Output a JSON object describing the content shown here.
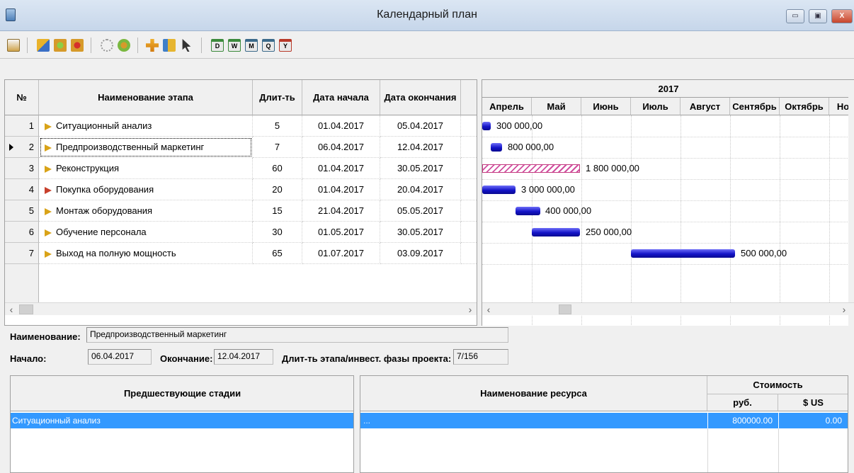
{
  "window": {
    "title": "Календарный план",
    "buttons": {
      "minimize": "▭",
      "maximize": "▣",
      "close": "X"
    }
  },
  "toolbar": {
    "icons": [
      "calendar-icon",
      "arrow-add-icon",
      "gear-green-icon",
      "gear-red-icon",
      "link-icon",
      "gear-link-icon",
      "plus-icon",
      "tree-icon",
      "pointer-icon",
      "day-icon",
      "week-icon",
      "month-icon",
      "quarter-icon",
      "year-icon"
    ],
    "scale_labels": [
      "D",
      "W",
      "M",
      "Q",
      "Y"
    ]
  },
  "table": {
    "headers": {
      "num": "№",
      "name": "Наименование этапа",
      "duration": "Длит-ть",
      "start": "Дата начала",
      "end": "Дата окончания"
    },
    "rows": [
      {
        "num": "1",
        "name": "Ситуационный анализ",
        "duration": "5",
        "start": "01.04.2017",
        "end": "05.04.2017",
        "cost": "300 000,00",
        "red": false
      },
      {
        "num": "2",
        "name": "Предпроизводственный маркетинг",
        "duration": "7",
        "start": "06.04.2017",
        "end": "12.04.2017",
        "cost": "800 000,00",
        "red": false,
        "selected": true
      },
      {
        "num": "3",
        "name": "Реконструкция",
        "duration": "60",
        "start": "01.04.2017",
        "end": "30.05.2017",
        "cost": "1 800 000,00",
        "red": false,
        "hatched": true
      },
      {
        "num": "4",
        "name": "Покупка оборудования",
        "duration": "20",
        "start": "01.04.2017",
        "end": "20.04.2017",
        "cost": "3 000 000,00",
        "red": true
      },
      {
        "num": "5",
        "name": "Монтаж оборудования",
        "duration": "15",
        "start": "21.04.2017",
        "end": "05.05.2017",
        "cost": "400 000,00",
        "red": false
      },
      {
        "num": "6",
        "name": "Обучение персонала",
        "duration": "30",
        "start": "01.05.2017",
        "end": "30.05.2017",
        "cost": "250 000,00",
        "red": false
      },
      {
        "num": "7",
        "name": "Выход на полную мощность",
        "duration": "65",
        "start": "01.07.2017",
        "end": "03.09.2017",
        "cost": "500 000,00",
        "red": false
      }
    ]
  },
  "gantt": {
    "year": "2017",
    "months": [
      "Апрель",
      "Май",
      "Июнь",
      "Июль",
      "Август",
      "Сентябрь",
      "Октябрь",
      "Но"
    ],
    "timeline_start": "2017-04-01"
  },
  "details": {
    "name_label": "Наименование:",
    "name_value": "Предпроизводственный маркетинг",
    "start_label": "Начало:",
    "start_value": "06.04.2017",
    "end_label": "Окончание:",
    "end_value": "12.04.2017",
    "phase_label": "Длит-ть этапа/инвест. фазы проекта:",
    "phase_value": "7/156"
  },
  "predecessors": {
    "header": "Предшествующие стадии",
    "items": [
      "Ситуационный анализ"
    ]
  },
  "resources": {
    "header": "Наименование ресурса",
    "cost_header": "Стоимость",
    "rub_header": "руб.",
    "usd_header": "$ US",
    "row": {
      "name": "...",
      "rub": "800000.00",
      "usd": "0.00"
    }
  },
  "scroll": {
    "left": "‹",
    "right": "›",
    "up": "˄",
    "down": "˅"
  }
}
